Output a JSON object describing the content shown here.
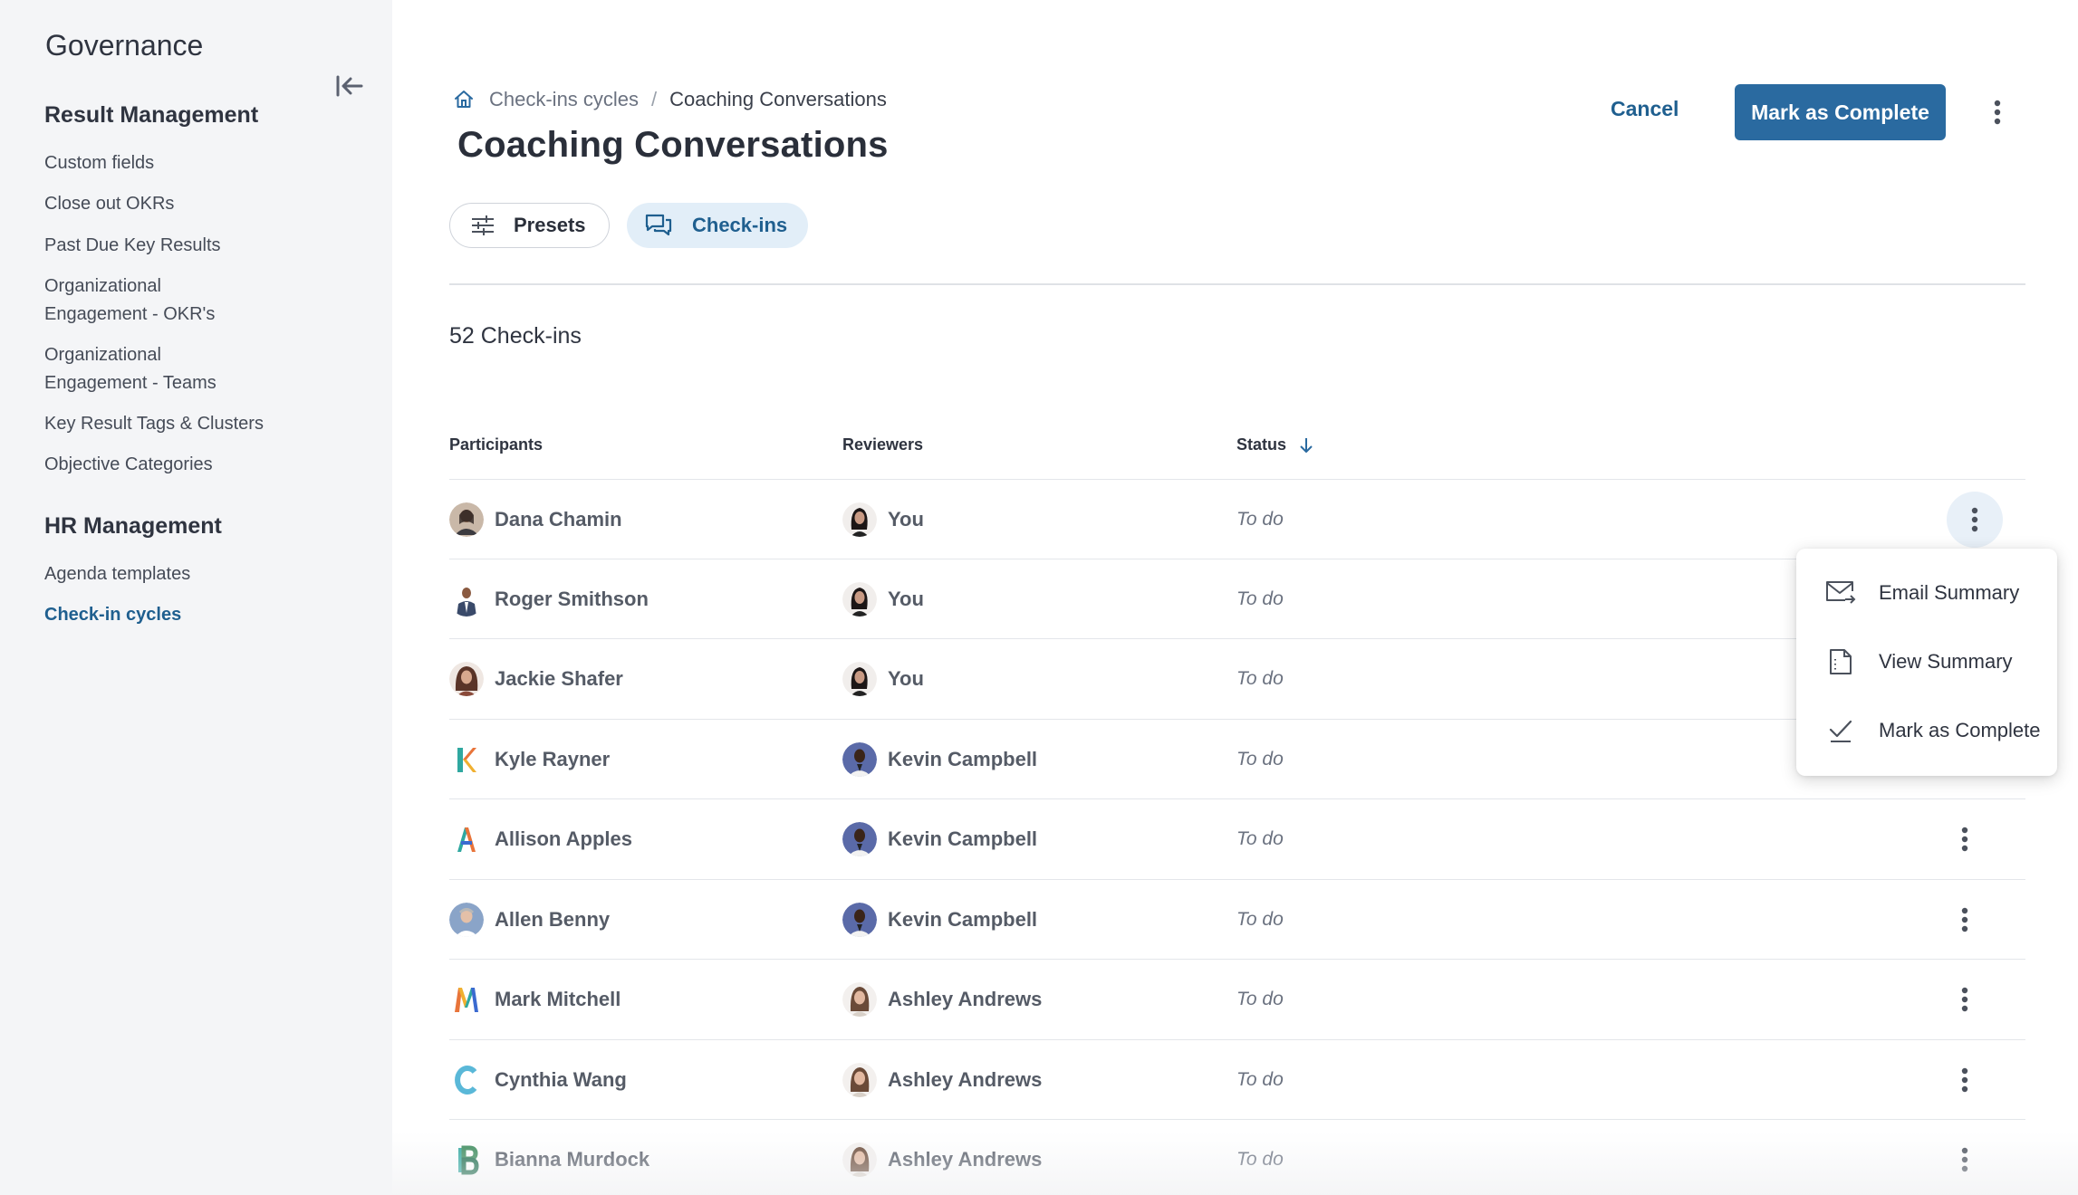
{
  "sidebar": {
    "title": "Governance",
    "sections": [
      {
        "heading": "Result Management",
        "items": [
          {
            "label": "Custom fields"
          },
          {
            "label": "Close out OKRs"
          },
          {
            "label": "Past Due Key Results"
          },
          {
            "label": "Organizational Engagement - OKR's"
          },
          {
            "label": "Organizational Engagement - Teams"
          },
          {
            "label": "Key Result Tags & Clusters"
          },
          {
            "label": "Objective Categories"
          }
        ]
      },
      {
        "heading": "HR Management",
        "items": [
          {
            "label": "Agenda templates"
          },
          {
            "label": "Check-in cycles",
            "active": true
          }
        ]
      }
    ]
  },
  "breadcrumb": {
    "home_icon": "home-icon",
    "items": [
      "Check-ins cycles",
      "Coaching Conversations"
    ],
    "separator": "/"
  },
  "page": {
    "title": "Coaching Conversations",
    "cancel_label": "Cancel",
    "primary_label": "Mark as Complete",
    "count_label": "52 Check-ins"
  },
  "tabs": [
    {
      "label": "Presets",
      "icon": "sliders-icon",
      "active": false
    },
    {
      "label": "Check-ins",
      "icon": "chat-icon",
      "active": true
    }
  ],
  "table": {
    "columns": [
      "Participants",
      "Reviewers",
      "Status"
    ],
    "sort_icon": "arrow-down-icon",
    "rows": [
      {
        "participant": "Dana Chamin",
        "reviewer": "You",
        "status": "To do"
      },
      {
        "participant": "Roger Smithson",
        "reviewer": "You",
        "status": "To do"
      },
      {
        "participant": "Jackie Shafer",
        "reviewer": "You",
        "status": "To do"
      },
      {
        "participant": "Kyle Rayner",
        "participant_letter": "K",
        "reviewer": "Kevin Campbell",
        "status": "To do"
      },
      {
        "participant": "Allison Apples",
        "participant_letter": "A",
        "reviewer": "Kevin Campbell",
        "status": "To do"
      },
      {
        "participant": "Allen Benny",
        "reviewer": "Kevin Campbell",
        "status": "To do"
      },
      {
        "participant": "Mark Mitchell",
        "participant_letter": "M",
        "reviewer": "Ashley Andrews",
        "status": "To do"
      },
      {
        "participant": "Cynthia Wang",
        "participant_letter": "C",
        "reviewer": "Ashley Andrews",
        "status": "To do"
      },
      {
        "participant": "Bianna Murdock",
        "participant_letter": "B",
        "reviewer": "Ashley Andrews",
        "status": "To do"
      }
    ]
  },
  "row_menu": {
    "items": [
      {
        "label": "Email Summary",
        "icon": "email-forward-icon"
      },
      {
        "label": "View Summary",
        "icon": "document-icon"
      },
      {
        "label": "Mark as Complete",
        "icon": "check-icon"
      }
    ]
  },
  "colors": {
    "accent": "#2a6aa0",
    "link": "#1f5f8f",
    "sidebar_bg": "#f4f5f7",
    "tab_active_bg": "#e2eef8"
  }
}
